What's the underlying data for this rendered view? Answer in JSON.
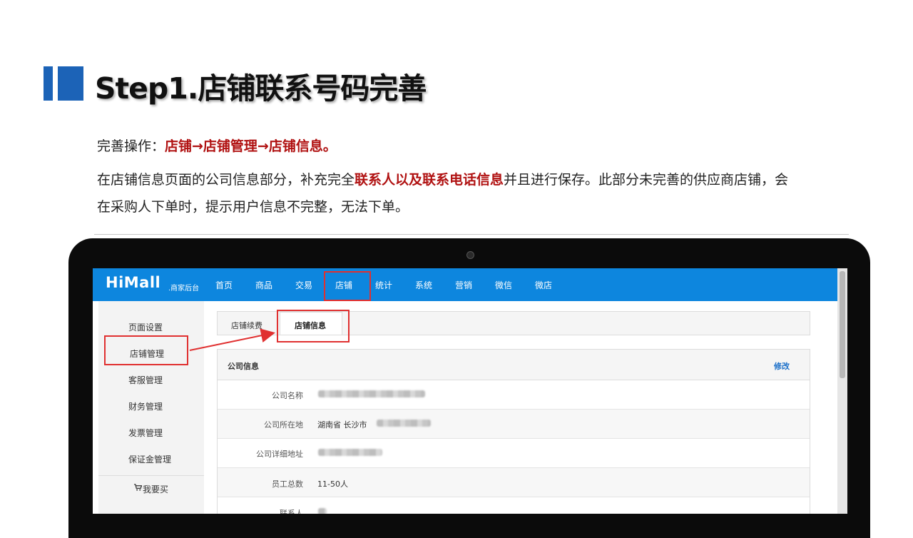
{
  "slide": {
    "title": "Step1.店铺联系号码完善",
    "line1_prefix": "完善操作：",
    "line1_highlight": "店铺→店铺管理→店铺信息。",
    "line2_a": "在店铺信息页面的公司信息部分，补充完全",
    "line2_highlight": "联系人以及联系电话信息",
    "line2_b": "并且进行保存。此部分未完善的供应商店铺，会",
    "line3": "在采购人下单时，提示用户信息不完整，无法下单。"
  },
  "app": {
    "logo": "HiMall",
    "logo_sub": ".商家后台",
    "nav": [
      "首页",
      "商品",
      "交易",
      "店铺",
      "统计",
      "系统",
      "营销",
      "微信",
      "微店"
    ],
    "active_nav": "店铺"
  },
  "sidebar": {
    "items": [
      "页面设置",
      "店铺管理",
      "客服管理",
      "财务管理",
      "发票管理",
      "保证金管理"
    ],
    "active": "店铺管理",
    "buy_label": "我要买"
  },
  "tabs": [
    "店铺续费",
    "店铺信息"
  ],
  "panel": {
    "title": "公司信息",
    "edit_label": "修改",
    "rows": [
      {
        "label": "公司名称",
        "value": ""
      },
      {
        "label": "公司所在地",
        "value": "湖南省 长沙市"
      },
      {
        "label": "公司详细地址",
        "value": ""
      },
      {
        "label": "员工总数",
        "value": "11-50人"
      },
      {
        "label": "联系人",
        "value": ""
      }
    ]
  },
  "colors": {
    "accent": "#0d86de",
    "highlight_text": "#b01111",
    "annotation_red": "#e03030",
    "title_block": "#1c63b7"
  }
}
